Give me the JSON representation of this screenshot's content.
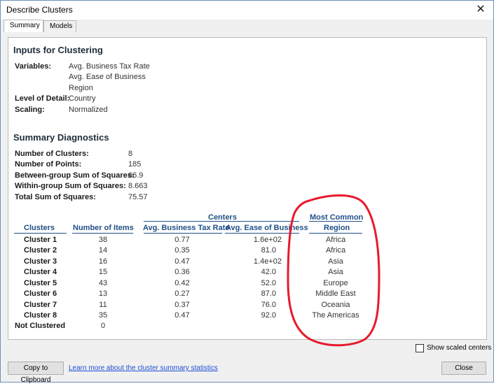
{
  "window": {
    "title": "Describe Clusters",
    "close_glyph": "✕"
  },
  "tabs": [
    {
      "label": "Summary",
      "active": true
    },
    {
      "label": "Models",
      "active": false
    }
  ],
  "inputs": {
    "heading": "Inputs for Clustering",
    "variables_label": "Variables:",
    "variables": [
      "Avg. Business Tax Rate",
      "Avg. Ease of Business",
      "Region"
    ],
    "level_label": "Level of Detail:",
    "level_value": "Country",
    "scaling_label": "Scaling:",
    "scaling_value": "Normalized"
  },
  "diagnostics": {
    "heading": "Summary Diagnostics",
    "rows": [
      {
        "label": "Number of Clusters:",
        "value": "8"
      },
      {
        "label": "Number of Points:",
        "value": "185"
      },
      {
        "label": "Between-group Sum of Squares:",
        "value": "66.9"
      },
      {
        "label": "Within-group Sum of Squares:",
        "value": "8.663"
      },
      {
        "label": "Total Sum of Squares:",
        "value": "75.57"
      }
    ]
  },
  "table": {
    "group_header_centers": "Centers",
    "group_header_most_common": "Most Common",
    "columns": [
      "Clusters",
      "Number of Items",
      "Avg. Business Tax Rate",
      "Avg. Ease of Business",
      "Region"
    ],
    "rows": [
      {
        "cluster": "Cluster 1",
        "items": "38",
        "tax": "0.77",
        "ease": "1.6e+02",
        "region": "Africa"
      },
      {
        "cluster": "Cluster 2",
        "items": "14",
        "tax": "0.35",
        "ease": "81.0",
        "region": "Africa"
      },
      {
        "cluster": "Cluster 3",
        "items": "16",
        "tax": "0.47",
        "ease": "1.4e+02",
        "region": "Asia"
      },
      {
        "cluster": "Cluster 4",
        "items": "15",
        "tax": "0.36",
        "ease": "42.0",
        "region": "Asia"
      },
      {
        "cluster": "Cluster 5",
        "items": "43",
        "tax": "0.42",
        "ease": "52.0",
        "region": "Europe"
      },
      {
        "cluster": "Cluster 6",
        "items": "13",
        "tax": "0.27",
        "ease": "87.0",
        "region": "Middle East"
      },
      {
        "cluster": "Cluster 7",
        "items": "11",
        "tax": "0.37",
        "ease": "76.0",
        "region": "Oceania"
      },
      {
        "cluster": "Cluster 8",
        "items": "35",
        "tax": "0.47",
        "ease": "92.0",
        "region": "The Americas"
      },
      {
        "cluster": "Not Clustered",
        "items": "0",
        "tax": "",
        "ease": "",
        "region": ""
      }
    ]
  },
  "footer": {
    "show_scaled_label": "Show scaled centers",
    "show_scaled_checked": false,
    "copy_button": "Copy to Clipboard",
    "learn_link": "Learn more about the cluster summary statistics",
    "close_button": "Close"
  },
  "colors": {
    "header_blue": "#1f4f86",
    "annotation_red": "#e8192c",
    "link_blue": "#1e4fd6"
  }
}
